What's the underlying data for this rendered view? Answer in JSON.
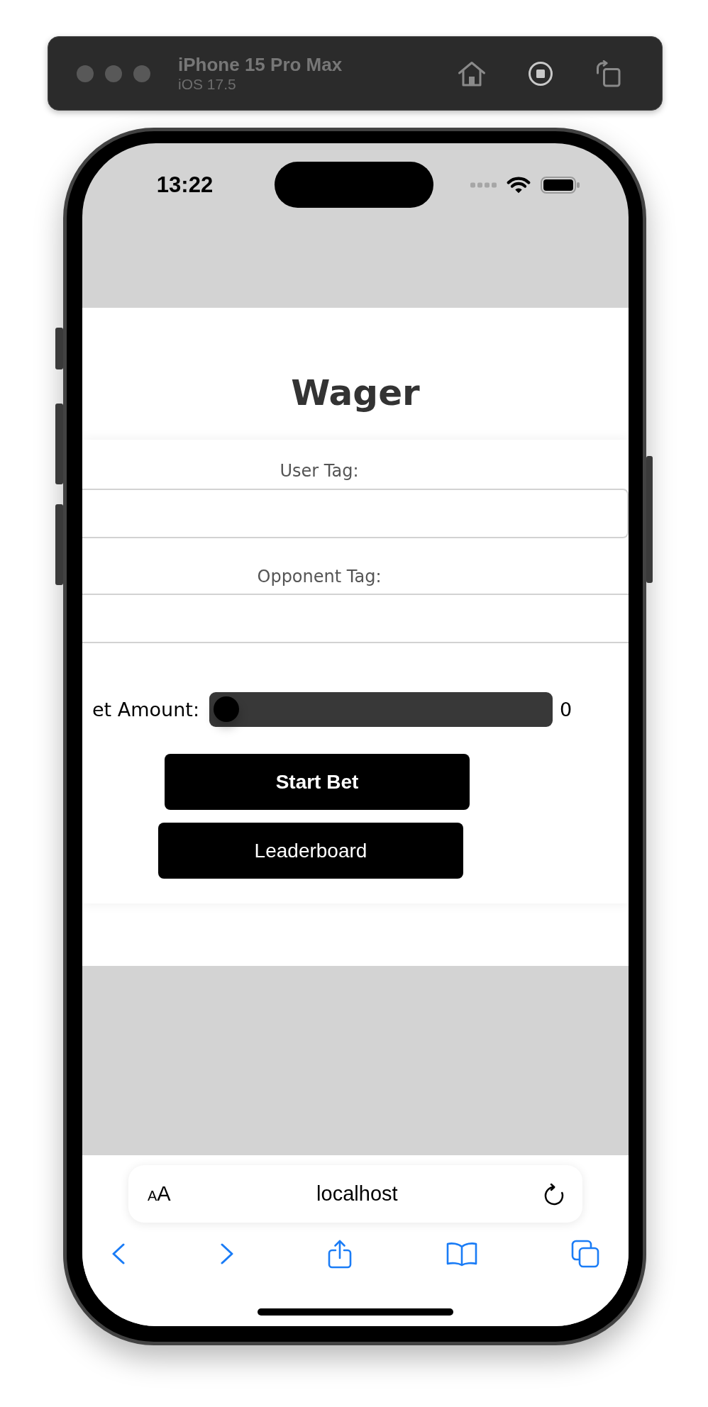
{
  "simulator": {
    "device": "iPhone 15 Pro Max",
    "os": "iOS 17.5"
  },
  "status_bar": {
    "time": "13:22"
  },
  "page": {
    "title": "Wager",
    "fields": [
      {
        "label": "User Tag:"
      },
      {
        "label": "Opponent Tag:"
      }
    ],
    "bet": {
      "label": "et Amount:",
      "level": 0,
      "reading": "0"
    },
    "buttons": [
      {
        "label": "Start Bet",
        "bold": true
      },
      {
        "label": "Leaderboard",
        "bold": false
      }
    ]
  },
  "browser": {
    "text_size": "AA",
    "address": "localhost"
  }
}
